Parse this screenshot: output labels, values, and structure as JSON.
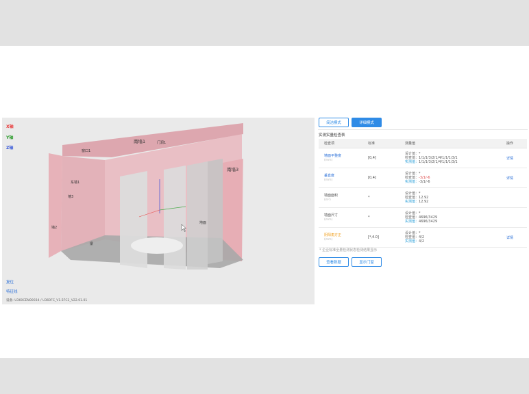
{
  "viewer": {
    "axis_x": "X轴",
    "axis_y": "Y轴",
    "axis_z": "Z轴",
    "wall_labels": [
      "南墙1",
      "南墙3",
      "门洞1",
      "窗口1",
      "东墙1",
      "墙2",
      "地面",
      "墙3",
      "梁"
    ],
    "reset_label": "复位",
    "mark_label": "特征线",
    "device_info": "设备: U360CEN00034 / U360FC_V1.5FC1_V22.01.01",
    "colors": {
      "wall": "#e6aab2",
      "floor": "#a9a9a9",
      "opening": "#dcdcdc"
    }
  },
  "panel": {
    "mode_simple": "简洁模式",
    "mode_detail": "详细模式",
    "table_title": "实测实量检查表",
    "headers": [
      "检查项",
      "标准",
      "测量值",
      "操作"
    ],
    "rows": [
      {
        "name": "墙面平整度",
        "unit": "(mm)",
        "name_style": "blue",
        "standard": "[0,4]",
        "lines": [
          {
            "k": "设计值：",
            "v": "*",
            "k_style": "",
            "v_style": ""
          },
          {
            "k": "检查值：",
            "v": "1/1/1/3/2/1/4/1/1/1/3/1",
            "k_style": "",
            "v_style": ""
          },
          {
            "k": "实测值：",
            "v": "1/1/1/3/2/1/4/1/1/1/3/1",
            "k_style": "blue",
            "v_style": ""
          }
        ],
        "action": "详情"
      },
      {
        "name": "垂直度",
        "unit": "(mm)",
        "name_style": "blue",
        "standard": "[0,4]",
        "lines": [
          {
            "k": "设计值：",
            "v": "*",
            "k_style": "",
            "v_style": ""
          },
          {
            "k": "检查值：",
            "v": "-3/1/-6",
            "k_style": "",
            "v_style": "red"
          },
          {
            "k": "实测值：",
            "v": "-3/1/-6",
            "k_style": "blue",
            "v_style": ""
          }
        ],
        "action": "详情"
      },
      {
        "name": "墙面面积",
        "unit": "(m²)",
        "name_style": "dark",
        "standard": "*",
        "lines": [
          {
            "k": "设计值：",
            "v": "*",
            "k_style": "",
            "v_style": ""
          },
          {
            "k": "检查值：",
            "v": "12.92",
            "k_style": "",
            "v_style": ""
          },
          {
            "k": "实测值：",
            "v": "12.92",
            "k_style": "blue",
            "v_style": ""
          }
        ],
        "action": ""
      },
      {
        "name": "墙面尺寸",
        "unit": "(mm)",
        "name_style": "dark",
        "standard": "*",
        "lines": [
          {
            "k": "设计值：",
            "v": "*",
            "k_style": "",
            "v_style": ""
          },
          {
            "k": "检查值：",
            "v": "4696/3429",
            "k_style": "",
            "v_style": ""
          },
          {
            "k": "实测值：",
            "v": "4696/3429",
            "k_style": "blue",
            "v_style": ""
          }
        ],
        "action": ""
      },
      {
        "name": "阴阳角方正",
        "unit": "(mm)",
        "name_style": "orange",
        "standard": "[*,4.0]",
        "lines": [
          {
            "k": "设计值：",
            "v": "*",
            "k_style": "",
            "v_style": ""
          },
          {
            "k": "检查值：",
            "v": "4/2",
            "k_style": "",
            "v_style": ""
          },
          {
            "k": "实测值：",
            "v": "4/2",
            "k_style": "blue",
            "v_style": ""
          }
        ],
        "action": "详情"
      }
    ],
    "footnote": "* 企业标准全量检测状态检测结果显示",
    "btn_view_data": "查看数据",
    "btn_show_door": "显示门窗"
  }
}
